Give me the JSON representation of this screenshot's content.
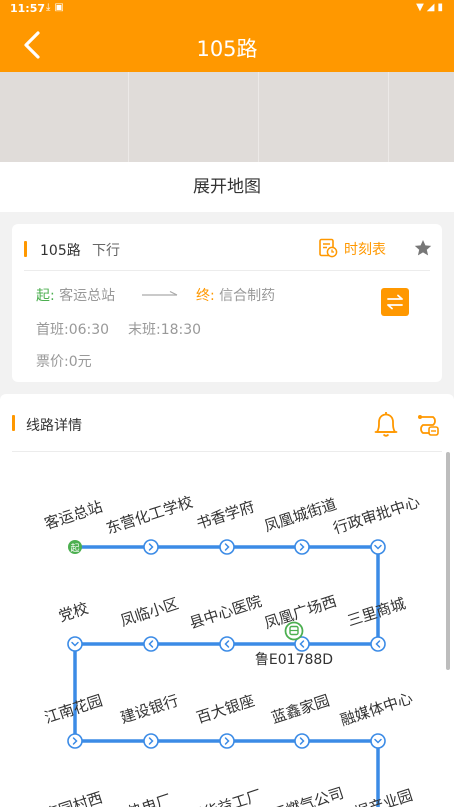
{
  "status_bar": {
    "time": "11:57"
  },
  "header": {
    "title": "105路"
  },
  "map": {
    "expand_label": "展开地图"
  },
  "info": {
    "route": "105路",
    "direction": "下行",
    "timetable_label": "时刻表",
    "start_prefix": "起:",
    "start_station": "客运总站",
    "end_prefix": "终:",
    "end_station": "信合制药",
    "first_label": "首班:",
    "first_time": "06:30",
    "last_label": "末班:",
    "last_time": "18:30",
    "fare_label": "票价:",
    "fare": "0元"
  },
  "details": {
    "title": "线路详情"
  },
  "route_diagram": {
    "rows": [
      [
        "客运总站",
        "东营化工学校",
        "书香学府",
        "凤凰城街道",
        "行政审批中心"
      ],
      [
        "三里商城",
        "凤凰广场西",
        "县中心医院",
        "凤临小区",
        "党校"
      ],
      [
        "江南花园",
        "建设银行",
        "百大银座",
        "蓝鑫家园",
        "融媒体中心"
      ],
      [
        "数据产业园",
        "天汇燃气公司",
        "利华益工厂",
        "热电厂",
        "枣园村西"
      ]
    ],
    "start_marker": "起",
    "bus_plate": "鲁E01788D",
    "colors": {
      "line": "#3b8be6",
      "start": "#4caf50",
      "bus": "#4caf50"
    }
  },
  "colors": {
    "accent": "#ff9800",
    "green": "#4caf50",
    "line_blue": "#3b8be6"
  }
}
